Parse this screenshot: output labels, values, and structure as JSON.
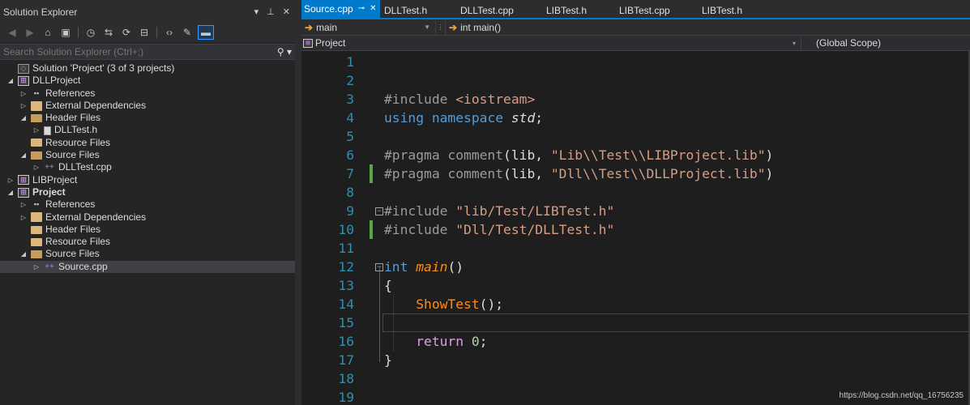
{
  "solution_explorer": {
    "title": "Solution Explorer",
    "title_actions": [
      "▾",
      "⊥",
      "✕"
    ],
    "search": {
      "placeholder": "Search Solution Explorer (Ctrl+;)"
    },
    "tree": [
      {
        "label": "Solution 'Project' (3 of 3 projects)",
        "icon": "solution-icon",
        "depth": 0,
        "arrow": ""
      },
      {
        "label": "DLLProject",
        "icon": "cpp-project-icon",
        "depth": 0,
        "arrow": "open"
      },
      {
        "label": "References",
        "icon": "references-icon",
        "depth": 1,
        "arrow": "closed"
      },
      {
        "label": "External Dependencies",
        "icon": "external-dependencies-icon",
        "depth": 1,
        "arrow": "closed"
      },
      {
        "label": "Header Files",
        "icon": "folder-open-icon",
        "depth": 1,
        "arrow": "open"
      },
      {
        "label": "DLLTest.h",
        "icon": "header-file-icon",
        "depth": 2,
        "arrow": "closed"
      },
      {
        "label": "Resource Files",
        "icon": "folder-icon",
        "depth": 1,
        "arrow": ""
      },
      {
        "label": "Source Files",
        "icon": "folder-open-icon",
        "depth": 1,
        "arrow": "open"
      },
      {
        "label": "DLLTest.cpp",
        "icon": "cpp-file-icon",
        "depth": 2,
        "arrow": "closed"
      },
      {
        "label": "LIBProject",
        "icon": "cpp-project-icon",
        "depth": 0,
        "arrow": "closed"
      },
      {
        "label": "Project",
        "icon": "cpp-project-icon",
        "depth": 0,
        "arrow": "open",
        "bold": true
      },
      {
        "label": "References",
        "icon": "references-icon",
        "depth": 1,
        "arrow": "closed"
      },
      {
        "label": "External Dependencies",
        "icon": "external-dependencies-icon",
        "depth": 1,
        "arrow": "closed"
      },
      {
        "label": "Header Files",
        "icon": "folder-icon",
        "depth": 1,
        "arrow": ""
      },
      {
        "label": "Resource Files",
        "icon": "folder-icon",
        "depth": 1,
        "arrow": ""
      },
      {
        "label": "Source Files",
        "icon": "folder-open-icon",
        "depth": 1,
        "arrow": "open"
      },
      {
        "label": "Source.cpp",
        "icon": "cpp-file-icon",
        "depth": 2,
        "arrow": "closed",
        "selected": true
      }
    ]
  },
  "editor": {
    "tabs": [
      {
        "label": "Source.cpp",
        "active": true
      },
      {
        "label": "DLLTest.h"
      },
      {
        "label": "DLLTest.cpp"
      },
      {
        "label": "LIBTest.h"
      },
      {
        "label": "LIBTest.cpp"
      },
      {
        "label": "LIBTest.h"
      }
    ],
    "nav_scope_left": "main",
    "nav_scope_right": "int main()",
    "project_dropdown": "Project",
    "global_scope": "(Global Scope)",
    "lines": [
      {
        "n": "1",
        "tokens": []
      },
      {
        "n": "2",
        "tokens": []
      },
      {
        "n": "3",
        "tokens": [
          [
            "pp",
            "#include "
          ],
          [
            "str",
            "<iostream>"
          ]
        ]
      },
      {
        "n": "4",
        "tokens": [
          [
            "kw",
            "using"
          ],
          [
            "",
            " "
          ],
          [
            "kw",
            "namespace"
          ],
          [
            "",
            " "
          ],
          [
            "it",
            "std"
          ],
          [
            "",
            ";"
          ]
        ]
      },
      {
        "n": "5",
        "tokens": []
      },
      {
        "n": "6",
        "tokens": [
          [
            "pp",
            "#pragma comment"
          ],
          [
            "",
            "(lib, "
          ],
          [
            "str",
            "\"Lib\\\\Test\\\\LIBProject.lib\""
          ],
          [
            "",
            ")"
          ]
        ]
      },
      {
        "n": "7",
        "tokens": [
          [
            "pp",
            "#pragma comment"
          ],
          [
            "",
            "(lib, "
          ],
          [
            "str",
            "\"Dll\\\\Test\\\\DLLProject.lib\""
          ],
          [
            "",
            ")"
          ]
        ],
        "modified": true
      },
      {
        "n": "8",
        "tokens": []
      },
      {
        "n": "9",
        "tokens": [
          [
            "pp",
            "#include "
          ],
          [
            "str",
            "\"lib/Test/LIBTest.h\""
          ]
        ],
        "fold": "⊟"
      },
      {
        "n": "10",
        "tokens": [
          [
            "pp",
            "#include "
          ],
          [
            "str",
            "\"Dll/Test/DLLTest.h\""
          ]
        ],
        "modified": true
      },
      {
        "n": "11",
        "tokens": []
      },
      {
        "n": "12",
        "tokens": [
          [
            "kw",
            "int"
          ],
          [
            "",
            " "
          ],
          [
            "fn it",
            "main"
          ],
          [
            "",
            "()"
          ]
        ],
        "fold": "⊟"
      },
      {
        "n": "13",
        "tokens": [
          [
            "",
            "{"
          ]
        ]
      },
      {
        "n": "14",
        "tokens": [
          [
            "",
            "    "
          ],
          [
            "fn",
            "ShowTest"
          ],
          [
            "",
            "();"
          ]
        ]
      },
      {
        "n": "15",
        "tokens": [],
        "current": true
      },
      {
        "n": "16",
        "tokens": [
          [
            "",
            "    "
          ],
          [
            "ctl",
            "return"
          ],
          [
            "",
            " "
          ],
          [
            "num",
            "0"
          ],
          [
            "",
            ";"
          ]
        ]
      },
      {
        "n": "17",
        "tokens": [
          [
            "",
            "}"
          ]
        ]
      },
      {
        "n": "18",
        "tokens": []
      },
      {
        "n": "19",
        "tokens": []
      }
    ]
  },
  "watermark": "https://blog.csdn.net/qq_16756235",
  "colors": {
    "accent": "#007acc",
    "keyword": "#569cd6",
    "string": "#d69d85",
    "function": "#ff8c1a",
    "line_number": "#2b91af"
  }
}
